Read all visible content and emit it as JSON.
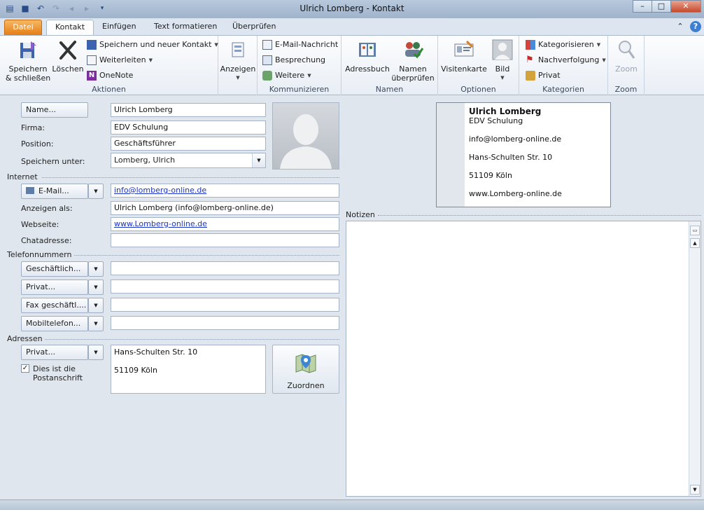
{
  "window": {
    "title": "Ulrich Lomberg  -  Kontakt",
    "minimize": "–",
    "maximize": "□",
    "close": "✕"
  },
  "tabs": [
    "Datei",
    "Kontakt",
    "Einfügen",
    "Text formatieren",
    "Überprüfen"
  ],
  "ribbon": {
    "aktionen": {
      "label": "Aktionen",
      "save_close": [
        "Speichern",
        "& schließen"
      ],
      "delete": "Löschen",
      "save_new": "Speichern und neuer Kontakt",
      "forward": "Weiterleiten",
      "onenote": "OneNote"
    },
    "anzeigen": {
      "label": "Anzeigen"
    },
    "kommunizieren": {
      "label": "Kommunizieren",
      "email": "E-Mail-Nachricht",
      "meeting": "Besprechung",
      "more": "Weitere"
    },
    "namen": {
      "label": "Namen",
      "addressbook": "Adressbuch",
      "check_names": [
        "Namen",
        "überprüfen"
      ]
    },
    "optionen": {
      "label": "Optionen",
      "business_card": "Visitenkarte",
      "picture": "Bild"
    },
    "kategorien": {
      "label": "Kategorien",
      "categorize": "Kategorisieren",
      "follow_up": "Nachverfolgung",
      "private": "Privat"
    },
    "zoom": {
      "label": "Zoom",
      "zoom": "Zoom"
    }
  },
  "form": {
    "name_button": "Name...",
    "name_value": "Ulrich Lomberg",
    "company_label": "Firma:",
    "company_value": "EDV Schulung",
    "position_label": "Position:",
    "position_value": "Geschäftsführer",
    "file_as_label": "Speichern unter:",
    "file_as_value": "Lomberg, Ulrich",
    "internet_section": "Internet",
    "email_button": "E-Mail...",
    "email_value": "info@lomberg-online.de",
    "display_as_label": "Anzeigen als:",
    "display_as_value": "Ulrich Lomberg (info@lomberg-online.de)",
    "webpage_label": "Webseite:",
    "webpage_value": "www.Lomberg-online.de",
    "im_label": "Chatadresse:",
    "im_value": "",
    "phone_section": "Telefonnummern",
    "phones": [
      {
        "label": "Geschäftlich...",
        "value": ""
      },
      {
        "label": "Privat...",
        "value": ""
      },
      {
        "label": "Fax geschäftl....",
        "value": ""
      },
      {
        "label": "Mobiltelefon...",
        "value": ""
      }
    ],
    "address_section": "Adressen",
    "address_button": "Privat...",
    "address_lines": [
      "Hans-Schulten Str. 10",
      "",
      "51109  Köln"
    ],
    "mailing_checkbox": [
      "Dies ist die",
      "Postanschrift"
    ],
    "map_button": "Zuordnen",
    "notes_section": "Notizen"
  },
  "business_card": {
    "name": "Ulrich Lomberg",
    "company": "EDV Schulung",
    "email": "info@lomberg-online.de",
    "street": "Hans-Schulten Str. 10",
    "city": "51109  Köln",
    "web": "www.Lomberg-online.de"
  },
  "colors": {
    "file_tab": "#e57d16",
    "link": "#1a34c4",
    "background": "#dfe6ee"
  }
}
